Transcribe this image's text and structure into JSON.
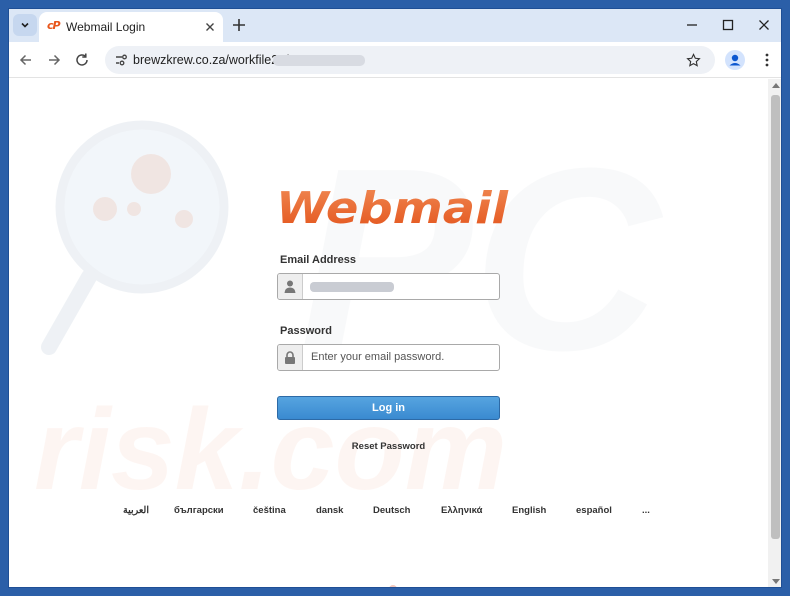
{
  "browser": {
    "tab": {
      "favicon_text": "cP",
      "title": "Webmail Login"
    },
    "address": {
      "url": "brewzkrew.co.za/workfile26/#"
    }
  },
  "page": {
    "logo_text": "Webmail",
    "email": {
      "label": "Email Address"
    },
    "password": {
      "label": "Password",
      "placeholder": "Enter your email password."
    },
    "login_button": "Log in",
    "reset_link": "Reset Password",
    "languages": [
      "العربية",
      "български",
      "čeština",
      "dansk",
      "Deutsch",
      "Ελληνικά",
      "English",
      "español"
    ],
    "more_languages": "..."
  },
  "watermark": {
    "top": "PC",
    "bottom": "risk.com"
  },
  "colors": {
    "brand": "#e8561b",
    "button": "#3f8fd4",
    "titlebar": "#dce7f6",
    "desktop": "#2b5fa8"
  },
  "icons": [
    "tab-search-icon",
    "cpanel-favicon-icon",
    "close-icon",
    "plus-icon",
    "minimize-icon",
    "maximize-icon",
    "back-arrow-icon",
    "forward-arrow-icon",
    "reload-icon",
    "site-info-icon",
    "bookmark-star-icon",
    "profile-icon",
    "more-menu-icon",
    "user-icon",
    "lock-icon"
  ]
}
